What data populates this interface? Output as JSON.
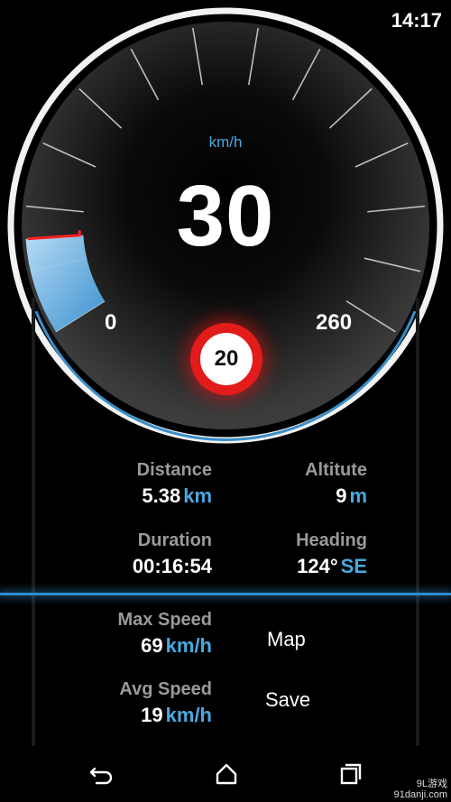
{
  "status_bar": {
    "time": "14:17"
  },
  "speedometer": {
    "unit": "km/h",
    "current_speed": "30",
    "current_speed_value": 30,
    "scale_min": "0",
    "scale_max": "260",
    "speed_limit": "20",
    "accent_color": "#4aa8e0",
    "limit_color": "#e21b1b"
  },
  "stats": {
    "distance": {
      "label": "Distance",
      "value": "5.38",
      "unit": "km"
    },
    "altitude": {
      "label": "Altitute",
      "value": "9",
      "unit": "m"
    },
    "duration": {
      "label": "Duration",
      "value": "00:16:54"
    },
    "heading": {
      "label": "Heading",
      "value": "124°",
      "unit": "SE"
    },
    "max_speed": {
      "label": "Max Speed",
      "value": "69",
      "unit": "km/h"
    },
    "avg_speed": {
      "label": "Avg Speed",
      "value": "19",
      "unit": "km/h"
    }
  },
  "menu": {
    "map": "Map",
    "save": "Save"
  },
  "nav": {
    "back_icon": "back-icon",
    "home_icon": "home-icon",
    "recents_icon": "recents-icon"
  },
  "watermark": {
    "brand": "9L游戏",
    "site": "91danji.com"
  }
}
